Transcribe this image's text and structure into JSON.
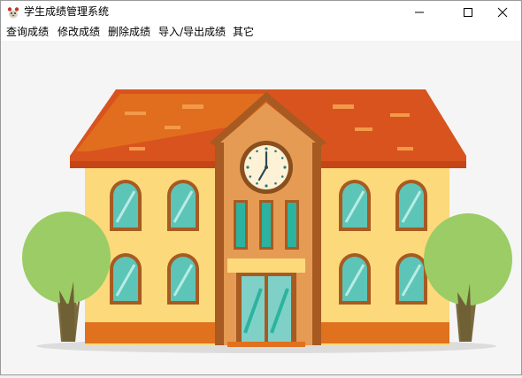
{
  "window": {
    "title": "学生成绩管理系统",
    "app_icon": "cartoon-mascot-icon"
  },
  "title_controls": {
    "minimize_icon": "minimize-icon",
    "maximize_icon": "maximize-icon",
    "close_icon": "close-icon"
  },
  "menu": {
    "items": [
      {
        "label": "查询成绩"
      },
      {
        "label": "修改成绩"
      },
      {
        "label": "删除成绩"
      },
      {
        "label": "导入/导出成绩"
      },
      {
        "label": "其它"
      }
    ]
  },
  "illustration": {
    "subject": "school-building",
    "clock_icon": "clock-icon",
    "colors": {
      "roof": "#d9531e",
      "wall": "#fcd97b",
      "tower": "#e59b53",
      "window_glass": "#2bb3a0",
      "tree": "#9ccc65",
      "trunk": "#7a6a3c"
    }
  }
}
